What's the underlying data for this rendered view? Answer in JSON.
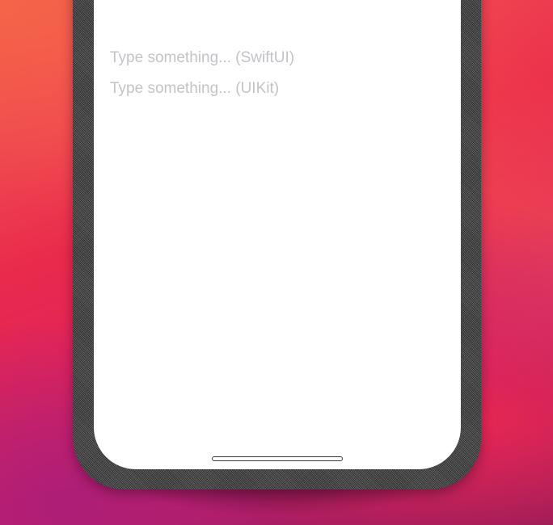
{
  "fields": {
    "swiftui_placeholder": "Type something... (SwiftUI)",
    "uikit_placeholder": "Type something... (UIKit)"
  },
  "colors": {
    "placeholder_text": "#c3c3c8",
    "screen_background": "#ffffff",
    "device_frame": "#5a5a5a"
  }
}
